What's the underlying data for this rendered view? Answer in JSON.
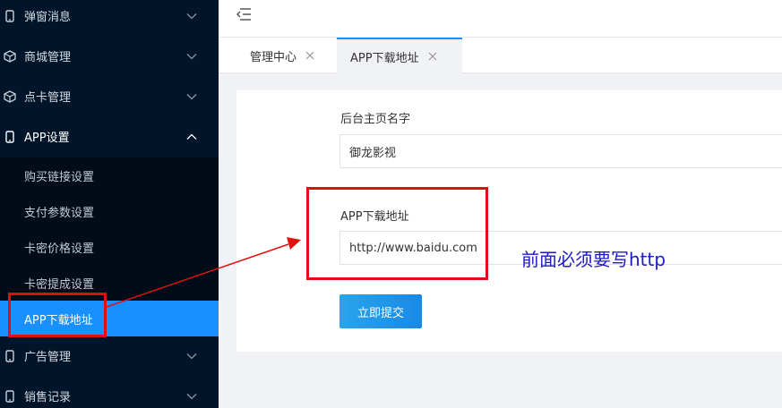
{
  "sidebar": {
    "items": [
      {
        "label": "弹窗消息",
        "icon": "phone-icon"
      },
      {
        "label": "商城管理",
        "icon": "box-icon"
      },
      {
        "label": "点卡管理",
        "icon": "box-icon"
      },
      {
        "label": "APP设置",
        "icon": "phone-icon"
      },
      {
        "label": "广告管理",
        "icon": "phone-icon"
      },
      {
        "label": "销售记录",
        "icon": "phone-icon"
      }
    ],
    "submenu": [
      {
        "label": "购买链接设置"
      },
      {
        "label": "支付参数设置"
      },
      {
        "label": "卡密价格设置"
      },
      {
        "label": "卡密提成设置"
      },
      {
        "label": "APP下载地址"
      }
    ]
  },
  "tabs": [
    {
      "label": "管理中心"
    },
    {
      "label": "APP下载地址"
    }
  ],
  "form": {
    "field1": {
      "label": "后台主页名字",
      "value": "御龙影视"
    },
    "field2": {
      "label": "APP下载地址",
      "value": "http://www.baidu.com"
    },
    "submit_label": "立即提交"
  },
  "annotation": {
    "note": "前面必须要写http",
    "color": "#e01010"
  },
  "colors": {
    "sidebar_bg": "#001529",
    "accent": "#1890ff"
  }
}
